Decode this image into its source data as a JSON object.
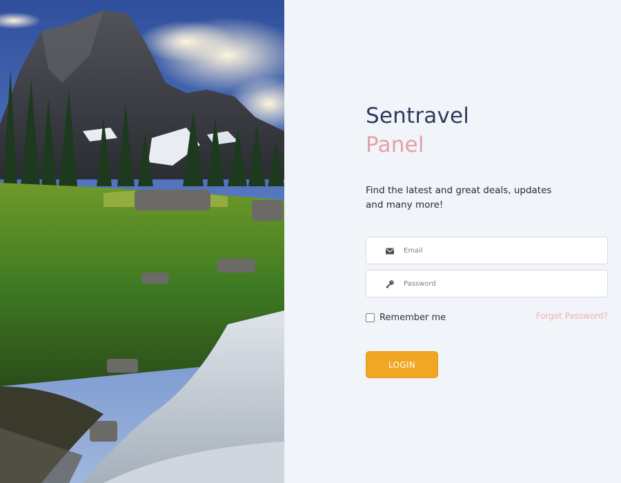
{
  "brand": {
    "title": "Sentravel",
    "subtitle": "Panel"
  },
  "tagline": "Find the latest and great deals, updates and many more!",
  "form": {
    "email": {
      "placeholder": "Email",
      "value": "",
      "icon": "envelope-icon"
    },
    "password": {
      "placeholder": "Password",
      "value": "",
      "icon": "key-icon"
    },
    "remember_label": "Remember me",
    "remember_checked": false,
    "forgot_label": "Forgot Password?",
    "login_label": "LOGIN"
  },
  "colors": {
    "background": "#f1f4f8",
    "title": "#2f3b5c",
    "subtitle": "#e5a0a8",
    "forgot_link": "#f0b3b6",
    "login_button": "#f0a824"
  }
}
